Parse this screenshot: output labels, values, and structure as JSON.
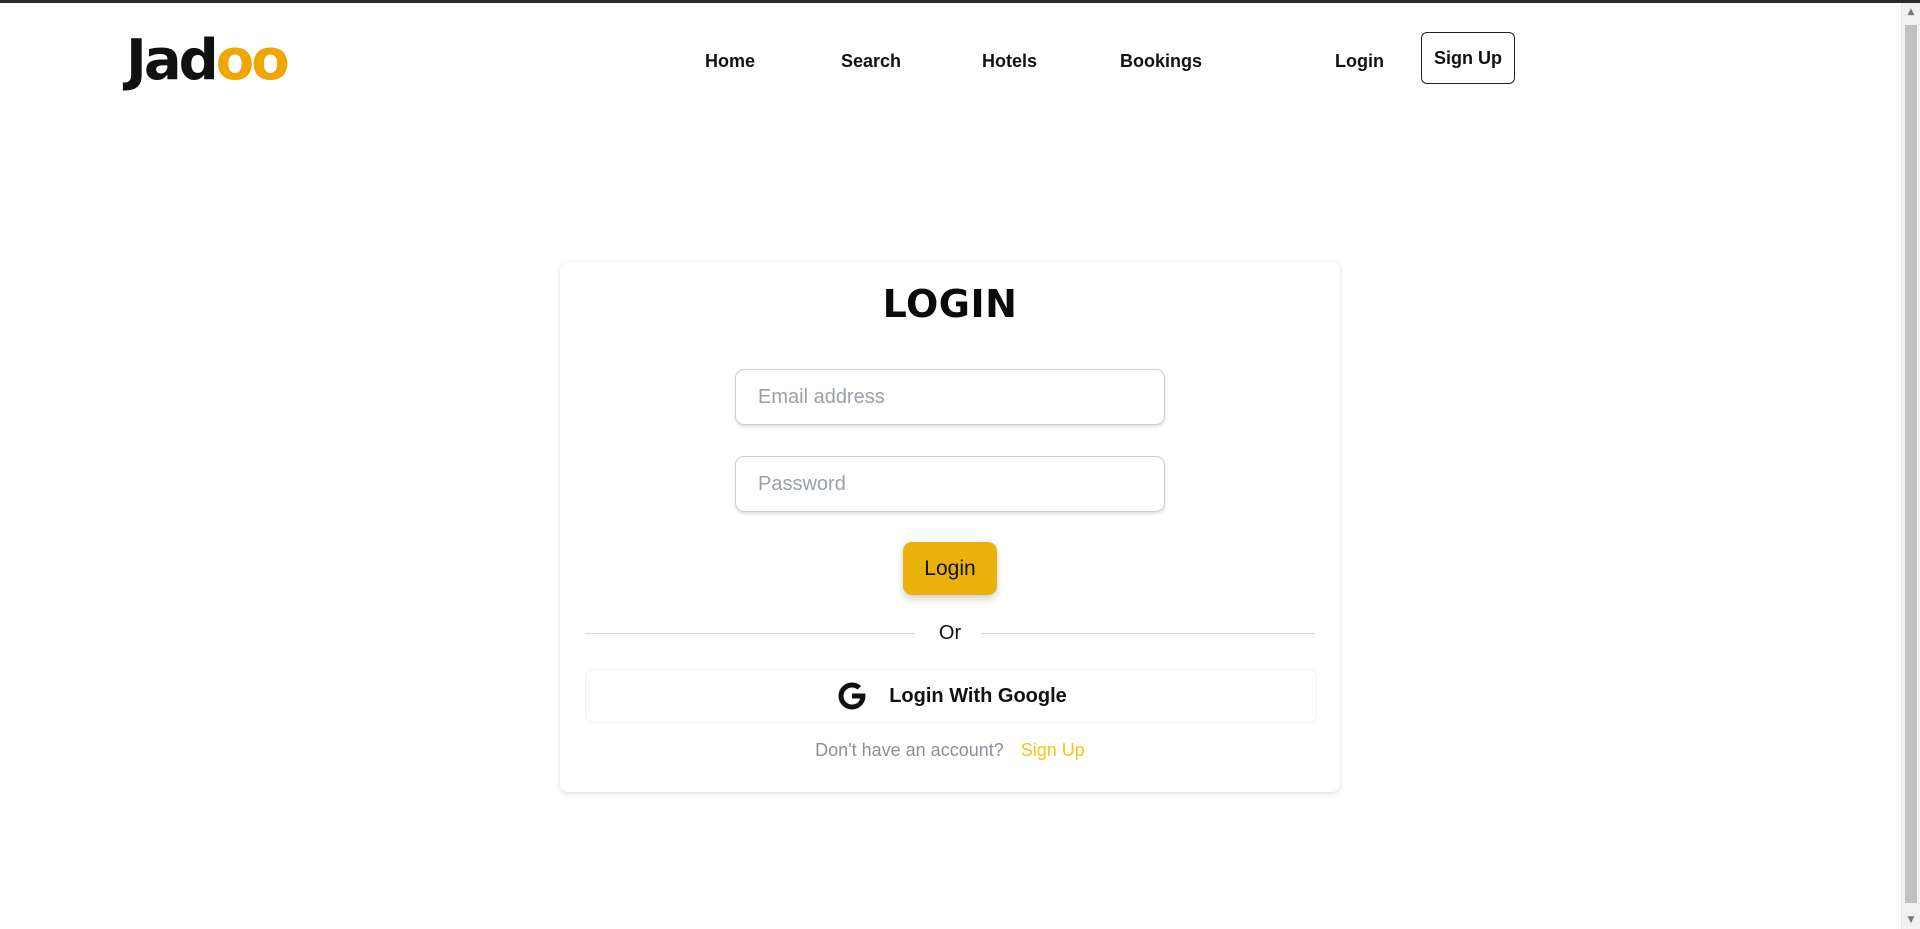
{
  "brand": {
    "logo_prefix": "Jad",
    "logo_suffix": "oo",
    "accent_color": "#f0a500"
  },
  "nav": {
    "links": [
      "Home",
      "Search",
      "Hotels",
      "Bookings"
    ],
    "login_label": "Login",
    "signup_label": "Sign Up"
  },
  "login_form": {
    "title": "LOGIN",
    "email_placeholder": "Email address",
    "password_placeholder": "Password",
    "submit_label": "Login",
    "submit_color": "#e9b109",
    "divider_text": "Or",
    "google_label": "Login With Google",
    "google_icon": "google-icon",
    "no_account_text": "Don't have an account?",
    "signup_link": "Sign Up",
    "signup_link_color": "#f5c518"
  }
}
